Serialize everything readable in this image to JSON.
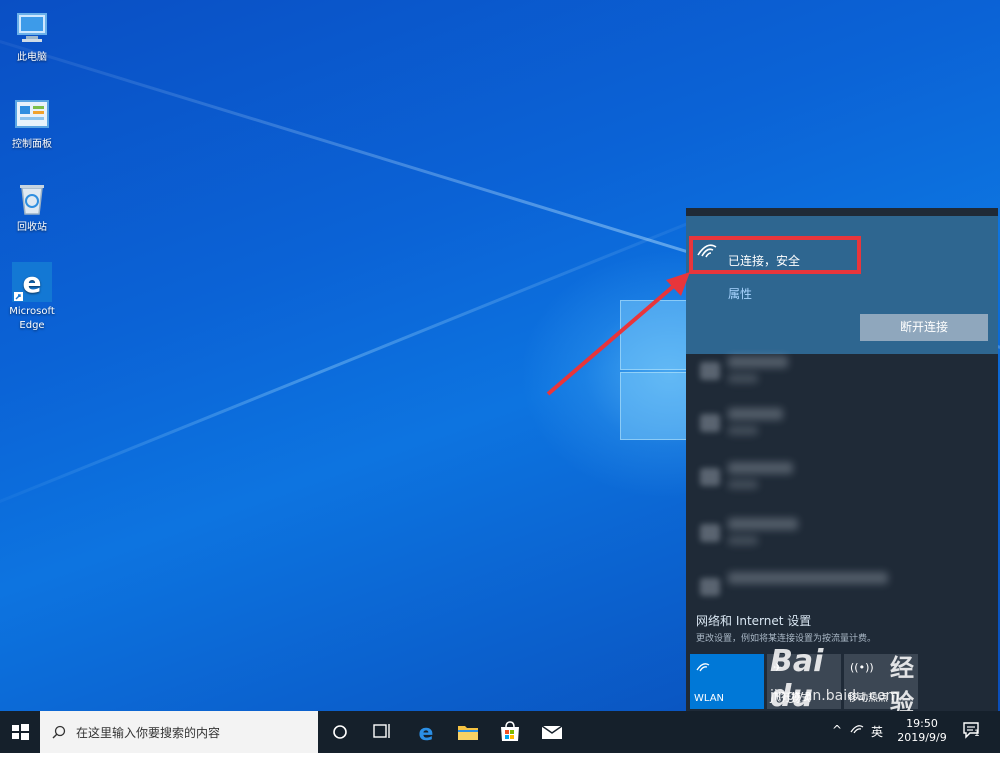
{
  "desktop": {
    "icons": [
      {
        "label": "此电脑",
        "icon": "this-pc-icon"
      },
      {
        "label": "控制面板",
        "icon": "control-panel-icon"
      },
      {
        "label": "回收站",
        "icon": "recycle-bin-icon"
      },
      {
        "label": "Microsoft Edge",
        "icon": "edge-icon"
      }
    ]
  },
  "flyout": {
    "status": "已连接，安全",
    "properties_link": "属性",
    "disconnect_button": "断开连接",
    "settings_title": "网络和 Internet 设置",
    "settings_subtitle": "更改设置，例如将某连接设置为按流量计费。",
    "tiles": [
      {
        "label": "WLAN",
        "icon": "wifi-icon",
        "active": true
      },
      {
        "label": "飞行模式",
        "icon": "airplane-icon",
        "active": false
      },
      {
        "label": "移动热点",
        "icon": "hotspot-icon",
        "active": false
      }
    ]
  },
  "taskbar": {
    "search_placeholder": "在这里输入你要搜索的内容",
    "ime_label": "英",
    "clock_time": "19:50",
    "clock_date": "2019/9/9",
    "notification_count": "1"
  },
  "watermark": {
    "logo": "Bai du",
    "text": "经验",
    "url": "jingyan.baidu.com"
  },
  "colors": {
    "taskbar": "#15202b",
    "flyout": "#1f2a37",
    "connected_panel": "#2e6690",
    "accent": "#0078d7",
    "annotation": "#e8353b"
  }
}
